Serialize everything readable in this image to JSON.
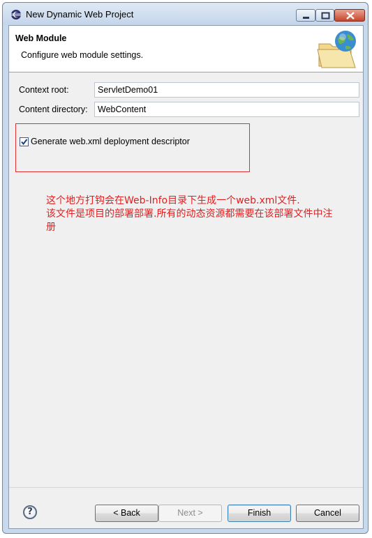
{
  "window": {
    "title": "New Dynamic Web Project"
  },
  "header": {
    "title": "Web Module",
    "description": "Configure web module settings."
  },
  "form": {
    "context_root_label": "Context root:",
    "context_root_value": "ServletDemo01",
    "content_dir_label": "Content directory:",
    "content_dir_value": "WebContent",
    "generate_checkbox_label": "Generate web.xml deployment descriptor",
    "generate_checked": true
  },
  "annotation": {
    "line1": "这个地方打钩会在Web-Info目录下生成一个web.xml文件.",
    "line2": "该文件是项目的部署部署.所有的动态资源都需要在该部署文件中注",
    "line3": "册"
  },
  "footer": {
    "help_glyph": "?",
    "back_label": "< Back",
    "next_label": "Next >",
    "finish_label": "Finish",
    "cancel_label": "Cancel"
  },
  "colors": {
    "annotation": "#e02020",
    "highlight_box": "#e03030"
  }
}
